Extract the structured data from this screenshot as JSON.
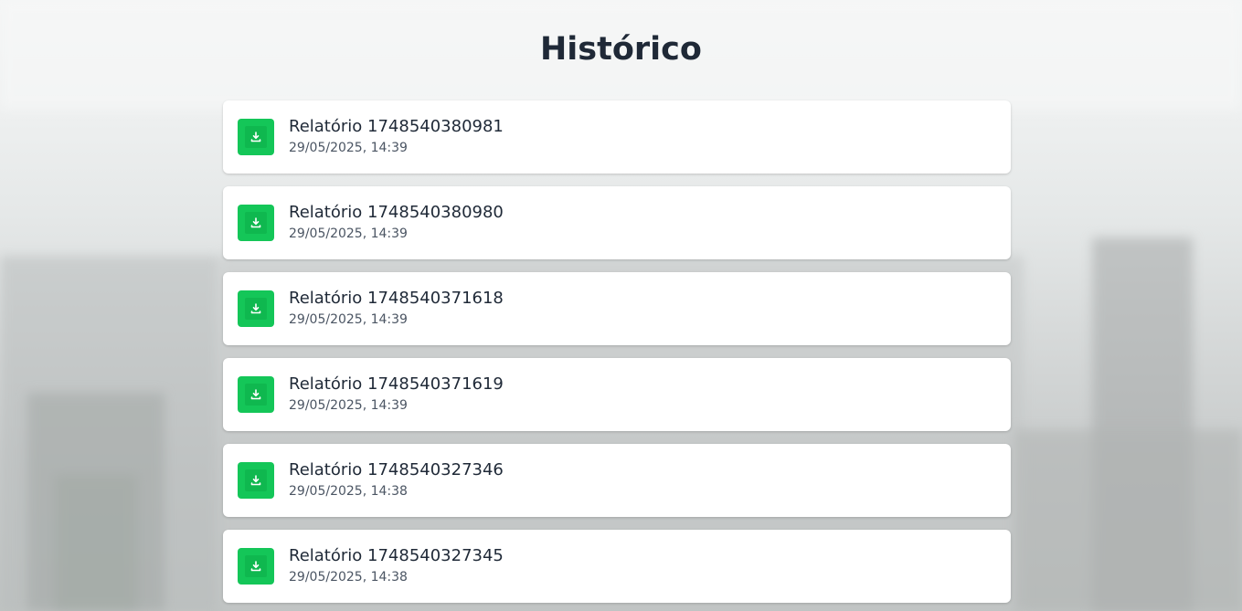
{
  "page": {
    "title": "Histórico"
  },
  "colors": {
    "accent": "#14c658",
    "text_primary": "#1f2937",
    "text_secondary": "#4b5563"
  },
  "reports": [
    {
      "name": "Relatório 1748540380981",
      "date": "29/05/2025, 14:39",
      "icon": "download-icon"
    },
    {
      "name": "Relatório 1748540380980",
      "date": "29/05/2025, 14:39",
      "icon": "download-icon"
    },
    {
      "name": "Relatório 1748540371618",
      "date": "29/05/2025, 14:39",
      "icon": "download-icon"
    },
    {
      "name": "Relatório 1748540371619",
      "date": "29/05/2025, 14:39",
      "icon": "download-icon"
    },
    {
      "name": "Relatório 1748540327346",
      "date": "29/05/2025, 14:38",
      "icon": "download-icon"
    },
    {
      "name": "Relatório 1748540327345",
      "date": "29/05/2025, 14:38",
      "icon": "download-icon"
    }
  ]
}
